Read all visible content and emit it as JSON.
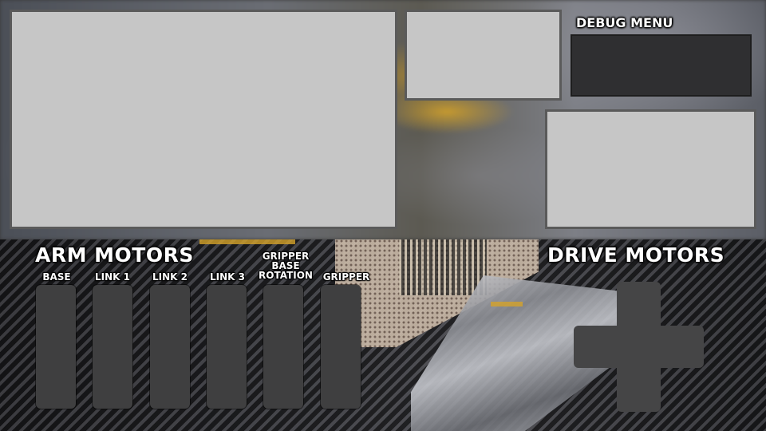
{
  "debug": {
    "title": "DEBUG MENU"
  },
  "arm": {
    "title": "ARM MOTORS",
    "motors": [
      {
        "label": "BASE"
      },
      {
        "label": "LINK 1"
      },
      {
        "label": "LINK 2"
      },
      {
        "label": "LINK 3"
      },
      {
        "label": "GRIPPER BASE ROTATION"
      },
      {
        "label": "GRIPPER"
      }
    ]
  },
  "drive": {
    "title": "DRIVE MOTORS"
  },
  "colors": {
    "panel": "#c6c6c6",
    "slider": "#3f3f40",
    "dpad": "#454546",
    "accent": "#d4a22a"
  }
}
